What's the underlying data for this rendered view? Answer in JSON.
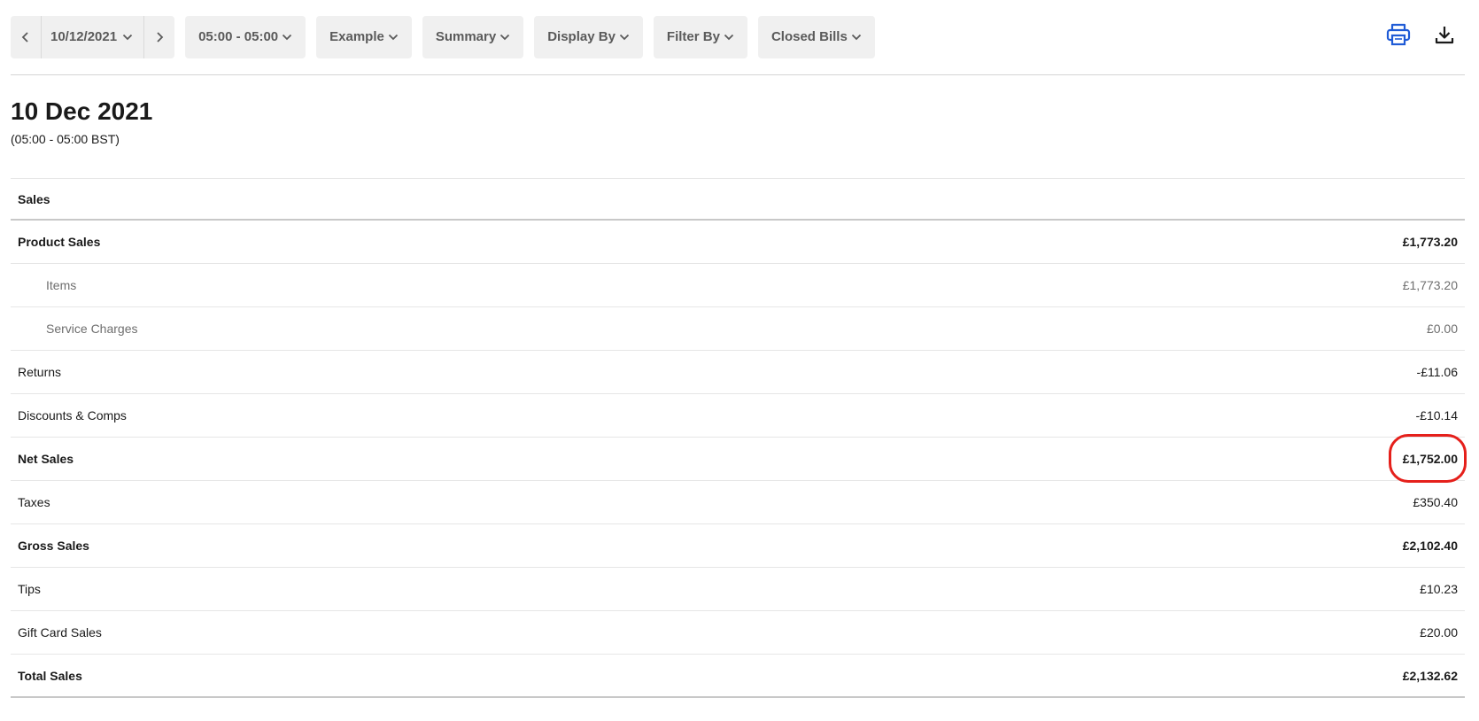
{
  "toolbar": {
    "date": "10/12/2021",
    "time_range": "05:00 - 05:00",
    "filters": {
      "example": "Example",
      "summary": "Summary",
      "display_by": "Display By",
      "filter_by": "Filter By",
      "closed_bills": "Closed Bills"
    },
    "icons": {
      "prev": "chevron-left-icon",
      "next": "chevron-right-icon",
      "print": "printer-icon",
      "download": "download-icon"
    },
    "colors": {
      "print_icon": "#1f5bd6",
      "button_bg": "#f0f0f0"
    }
  },
  "header": {
    "title": "10 Dec 2021",
    "subtitle": "(05:00 - 05:00 BST)"
  },
  "report": {
    "section_title": "Sales",
    "rows": [
      {
        "label": "Product Sales",
        "value": "£1,773.20"
      },
      {
        "label": "Items",
        "value": "£1,773.20"
      },
      {
        "label": "Service Charges",
        "value": "£0.00"
      },
      {
        "label": "Returns",
        "value": "-£11.06"
      },
      {
        "label": "Discounts & Comps",
        "value": "-£10.14"
      },
      {
        "label": "Net Sales",
        "value": "£1,752.00"
      },
      {
        "label": "Taxes",
        "value": "£350.40"
      },
      {
        "label": "Gross Sales",
        "value": "£2,102.40"
      },
      {
        "label": "Tips",
        "value": "£10.23"
      },
      {
        "label": "Gift Card Sales",
        "value": "£20.00"
      },
      {
        "label": "Total Sales",
        "value": "£2,132.62"
      }
    ],
    "highlight_color": "#e5201b"
  }
}
